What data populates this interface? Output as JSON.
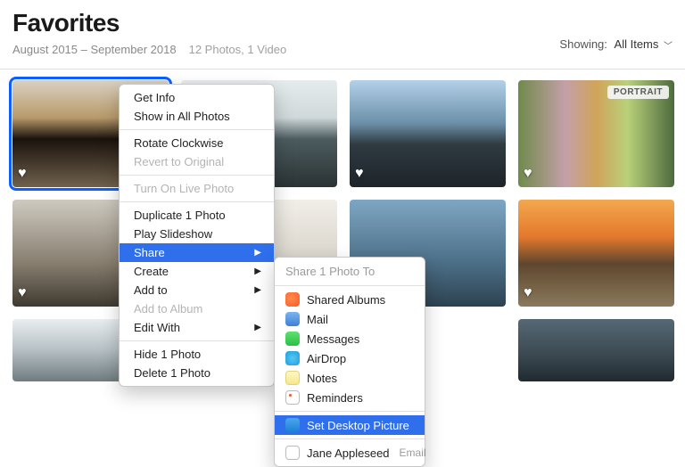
{
  "header": {
    "title": "Favorites",
    "date_range": "August 2015 – September 2018",
    "counts": "12 Photos, 1 Video"
  },
  "showing": {
    "label": "Showing:",
    "value": "All Items"
  },
  "badges": {
    "portrait": "PORTRAIT"
  },
  "menu": {
    "get_info": "Get Info",
    "show_in_all": "Show in All Photos",
    "rotate": "Rotate Clockwise",
    "revert": "Revert to Original",
    "live_photo": "Turn On Live Photo",
    "duplicate": "Duplicate 1 Photo",
    "slideshow": "Play Slideshow",
    "share": "Share",
    "create": "Create",
    "add_to": "Add to",
    "add_album": "Add to Album",
    "edit_with": "Edit With",
    "hide": "Hide 1 Photo",
    "delete": "Delete 1 Photo"
  },
  "share_menu": {
    "header": "Share 1 Photo To",
    "shared_albums": "Shared Albums",
    "mail": "Mail",
    "messages": "Messages",
    "airdrop": "AirDrop",
    "notes": "Notes",
    "reminders": "Reminders",
    "set_desktop": "Set Desktop Picture",
    "contact_name": "Jane Appleseed",
    "contact_hint": "Email"
  }
}
